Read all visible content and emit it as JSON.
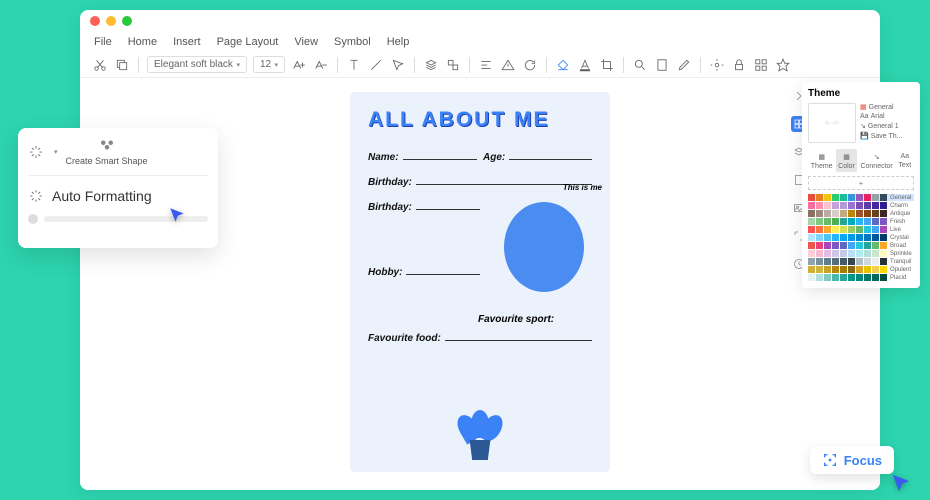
{
  "menu": {
    "file": "File",
    "home": "Home",
    "insert": "Insert",
    "page_layout": "Page Layout",
    "view": "View",
    "symbol": "Symbol",
    "help": "Help"
  },
  "toolbar": {
    "font": "Elegant soft black",
    "size": "12"
  },
  "popup1": {
    "create_smart": "Create Smart Shape",
    "auto_fmt": "Auto Formatting"
  },
  "doc": {
    "title": "ALL ABOUT ME",
    "name": "Name:",
    "age": "Age:",
    "bday1": "Birthday:",
    "bday2": "Birthday:",
    "hobby": "Hobby:",
    "fav_food": "Favourite food:",
    "fav_sport": "Favourite sport:",
    "thisme": "This is me"
  },
  "theme": {
    "title": "Theme",
    "opts": {
      "general": "General",
      "arial": "Arial",
      "general1": "General 1",
      "save": "Save Th..."
    },
    "tabs": {
      "theme": "Theme",
      "color": "Color",
      "connector": "Connector",
      "text": "Text"
    },
    "palettes": [
      "General",
      "Charm",
      "Antique",
      "Fresh",
      "Live",
      "Crystal",
      "Broad",
      "Sprinkle",
      "Tranquil",
      "Opulent",
      "Placid"
    ]
  },
  "palette_colors": {
    "General": [
      "#e74c3c",
      "#e67e22",
      "#f1c40f",
      "#2ecc71",
      "#1abc9c",
      "#3498db",
      "#9b59b6",
      "#e91e63",
      "#95a5a6",
      "#34495e"
    ],
    "Charm": [
      "#ff6b9d",
      "#ff8fab",
      "#ffc2d1",
      "#c9a0dc",
      "#b19cd9",
      "#9b72cf",
      "#7b4fb5",
      "#5d3fa8",
      "#4527a0",
      "#311b92"
    ],
    "Antique": [
      "#8d6e63",
      "#a1887f",
      "#bcaaa4",
      "#d7ccc8",
      "#c5a880",
      "#b8860b",
      "#a0522d",
      "#8b4513",
      "#654321",
      "#3e2723"
    ],
    "Fresh": [
      "#a5d6a7",
      "#81c784",
      "#66bb6a",
      "#4caf50",
      "#26a69a",
      "#00acc1",
      "#29b6f6",
      "#42a5f5",
      "#5c6bc0",
      "#7e57c2"
    ],
    "Live": [
      "#ff5252",
      "#ff7043",
      "#ffa726",
      "#ffee58",
      "#d4e157",
      "#9ccc65",
      "#66bb6a",
      "#26c6da",
      "#42a5f5",
      "#ab47bc"
    ],
    "Crystal": [
      "#b3e5fc",
      "#81d4fa",
      "#4fc3f7",
      "#29b6f6",
      "#03a9f4",
      "#039be5",
      "#0288d1",
      "#0277bd",
      "#01579b",
      "#013a6b"
    ],
    "Broad": [
      "#ef5350",
      "#ec407a",
      "#ab47bc",
      "#7e57c2",
      "#5c6bc0",
      "#42a5f5",
      "#26c6da",
      "#26a69a",
      "#66bb6a",
      "#ffa726"
    ],
    "Sprinkle": [
      "#ffcdd2",
      "#f8bbd0",
      "#e1bee7",
      "#d1c4e9",
      "#c5cae9",
      "#bbdefb",
      "#b2ebf2",
      "#b2dfdb",
      "#c8e6c9",
      "#fff9c4"
    ],
    "Tranquil": [
      "#90a4ae",
      "#78909c",
      "#607d8b",
      "#546e7a",
      "#455a64",
      "#37474f",
      "#b0bec5",
      "#cfd8dc",
      "#eceff1",
      "#263238"
    ],
    "Opulent": [
      "#d4af37",
      "#cfb53b",
      "#c9a227",
      "#b8860b",
      "#a67c00",
      "#8b6914",
      "#daa520",
      "#e6c200",
      "#f0d050",
      "#ffd700"
    ],
    "Placid": [
      "#e0f2f1",
      "#b2dfdb",
      "#80cbc4",
      "#4db6ac",
      "#26a69a",
      "#009688",
      "#00897b",
      "#00796b",
      "#00695c",
      "#004d40"
    ]
  },
  "focus": {
    "label": "Focus"
  }
}
